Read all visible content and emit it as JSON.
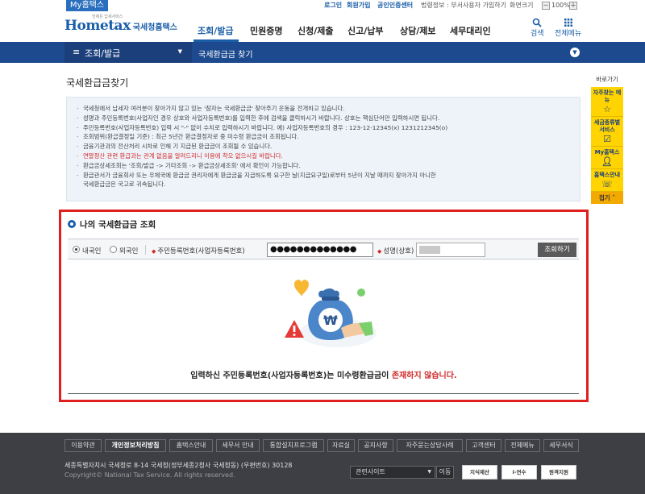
{
  "topbar": {
    "my_hometax": "My홈택스",
    "login": "로그인",
    "signup": "회원가입",
    "cert_center": "공인인증센터",
    "notice": "법령정보 : 부서사용자 가입하기",
    "zoom_label": "화면크기",
    "zoom_minus": "－",
    "zoom_value": "100%",
    "zoom_plus": "＋"
  },
  "header": {
    "logo_text": "Hometax",
    "logo_kr": "국세청홈택스",
    "logo_tag": "언제든 납세서비스",
    "nav": [
      "조회/발급",
      "민원증명",
      "신청/제출",
      "신고/납부",
      "상담/제보",
      "세무대리인"
    ],
    "search_label": "검색",
    "allmenu_label": "전체메뉴",
    "search_icon": "search-icon",
    "allmenu_icon": "grid-icon"
  },
  "subbar": {
    "menu_label": "조회/발급",
    "breadcrumb": "국세환급금 찾기"
  },
  "page": {
    "title": "국세환급금찾기"
  },
  "info": {
    "items": [
      {
        "text": "국세청에서 납세자 여러분이 찾아가지 않고 있는 '잠자는 국세환급금' 찾아주기 운동을 전개하고 있습니다.",
        "red": false,
        "cont": false
      },
      {
        "text": "성명과 주민등록번호(사업자인 경우 상호와 사업자등록번호)를 입력한 후에 검색을 클릭하시기 바랍니다. 상호는 핵심단어만 입력하시면 됩니다.",
        "red": false,
        "cont": false
      },
      {
        "text": "주민등록번호(사업자등록번호) 입력 시 \"-\" 없이 수치로 입력하시기 바랍니다. 예) 사업자등록번호의 경우 : 123-12-12345(x) 1231212345(o)",
        "red": false,
        "cont": false
      },
      {
        "text": "조회범위(환급결정일 기준) : 최근 5년간 환급결정자로 중 미수령 환급금이 조회됩니다.",
        "red": false,
        "cont": false
      },
      {
        "text": "금융기관과의 전산처리 시차로 인해 기 지급된 환급금이 조회될 수 있습니다.",
        "red": false,
        "cont": false
      },
      {
        "text": "연말정산 관련 환급과는 관계 없음을 알려드리니 이용에 착오 없으시길 바랍니다.",
        "red": true,
        "cont": false
      },
      {
        "text": "환급금상세조회는 '조회/발급 -> 기타조회 -> 환급금상세조회' 에서 확인이 가능합니다.",
        "red": false,
        "cont": false
      },
      {
        "text": "환급관서가 금융회사 또는 우체국에 환급금 권리자에게 환급금을 지급하도록 요구한 날(지급요구일)로부터 5년이 지날 때까지 찾아가지 아니한",
        "red": false,
        "cont": false
      },
      {
        "text": "국세환급금은 국고로 귀속됩니다.",
        "red": false,
        "cont": true
      }
    ]
  },
  "search": {
    "section_title": "나의 국세환급금 조회",
    "domestic": "내국인",
    "foreigner": "외국인",
    "id_label": "주민등록번호(사업자등록번호)",
    "id_value": "●●●●●●●●●●●●●",
    "name_label": "성명(상호)",
    "button": "조회하기"
  },
  "result": {
    "message_prefix": "입력하신 주민등록번호(사업자등록번호)는 미수령환급금이 ",
    "message_highlight": "존재하지 않습니다."
  },
  "quick": {
    "title": "바로가기",
    "items": [
      {
        "label": "자주찾는 메뉴",
        "icon": "star-icon"
      },
      {
        "label": "세금종류별 서비스",
        "icon": "checkbox-icon"
      },
      {
        "label": "My홈택스",
        "icon": "person-icon"
      },
      {
        "label": "홈택스안내",
        "icon": "help-icon"
      }
    ],
    "close": "접기"
  },
  "footer": {
    "links": [
      "이용약관",
      "개인정보처리방침",
      "홈택스안내",
      "세무서 안내",
      "통합설치프로그램",
      "자료실",
      "공지사항",
      "자주묻는상담사례",
      "고객센터",
      "전체메뉴",
      "세무서식"
    ],
    "address": "세종특별자치시 국세청로 8-14 국세청(정부세종2청사 국세청동) (우편번호) 30128",
    "copyright": "Copyright© National Tax Service. All rights reserved.",
    "related_select": "관련사이트",
    "go": "이동",
    "badges": [
      "지식재산",
      "i-연수",
      "원격지원"
    ]
  },
  "colors": {
    "brand_blue": "#1a5ea8",
    "subbar_blue": "#1d4a8e",
    "alert_red": "#e01f1f",
    "quick_yellow": "#ffd400",
    "footer_dark": "#3d3f44"
  }
}
